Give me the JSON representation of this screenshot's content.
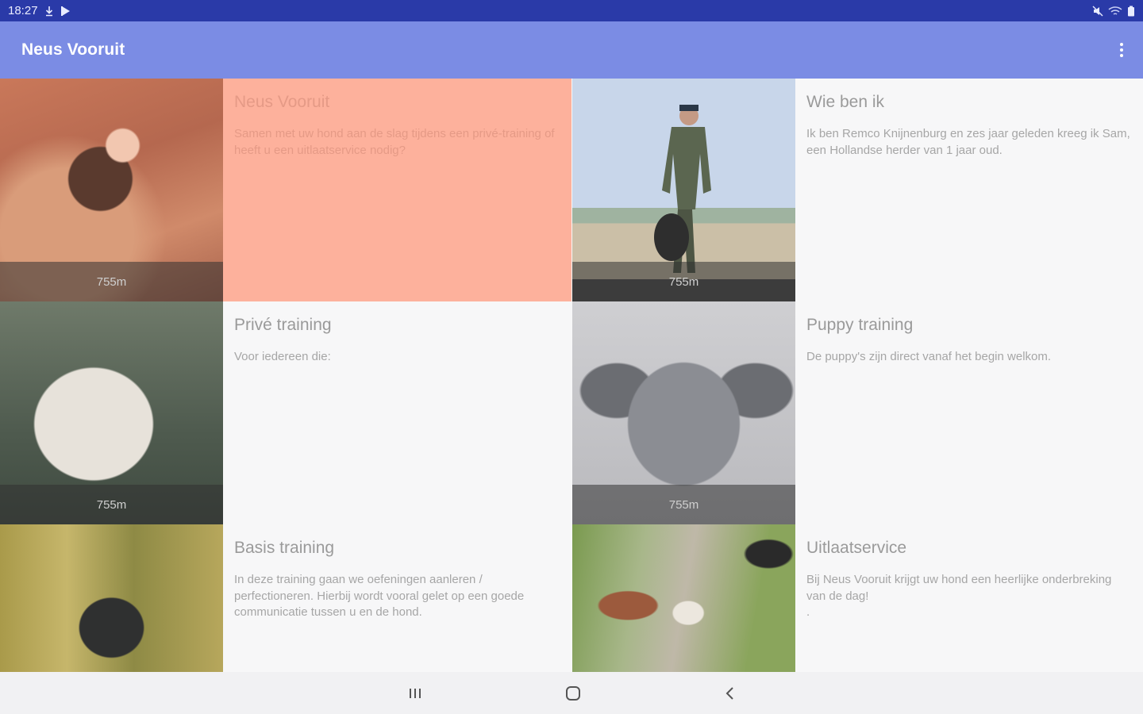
{
  "status_bar": {
    "time": "18:27"
  },
  "app_bar": {
    "title": "Neus Vooruit"
  },
  "cards": [
    {
      "title": "Neus Vooruit",
      "description": "Samen met uw hond aan de slag tijdens een privé-training of heeft u een uitlaatservice nodig?",
      "distance": "755m",
      "image": "dog-jumping-in-water",
      "highlighted": true
    },
    {
      "title": "Wie ben ik",
      "description": "Ik ben Remco Knijnenburg en zes jaar geleden kreeg ik Sam, een Hollandse herder van 1 jaar oud.",
      "distance": "755m",
      "image": "man-with-dog-on-beach"
    },
    {
      "title": "Privé training",
      "description": "Voor iedereen die:",
      "distance": "755m",
      "image": "golden-retriever-in-water"
    },
    {
      "title": "Puppy training",
      "description": "De puppy's zijn direct vanaf het begin welkom.",
      "distance": "755m",
      "image": "weimaraner-puppy"
    },
    {
      "title": "Basis training",
      "description": "In deze training gaan we oefeningen aanleren / perfectioneren. Hierbij wordt vooral  gelet op een goede communicatie tussen u en de hond.",
      "image": "shepherd-dog-in-field"
    },
    {
      "title": "Uitlaatservice",
      "description": "Bij Neus Vooruit krijgt uw hond een heerlijke onderbreking van de dag!",
      "extra": ".",
      "image": "dogs-walking-on-path"
    }
  ],
  "colors": {
    "status_bar": "#2a3aa8",
    "app_bar": "#7b8ce4",
    "highlight": "#fdb19c",
    "background": "#f7f7f8"
  },
  "icons": {
    "overflow": "more-vert-icon",
    "nav_recent": "recent-apps-icon",
    "nav_home": "home-icon",
    "nav_back": "back-icon"
  }
}
